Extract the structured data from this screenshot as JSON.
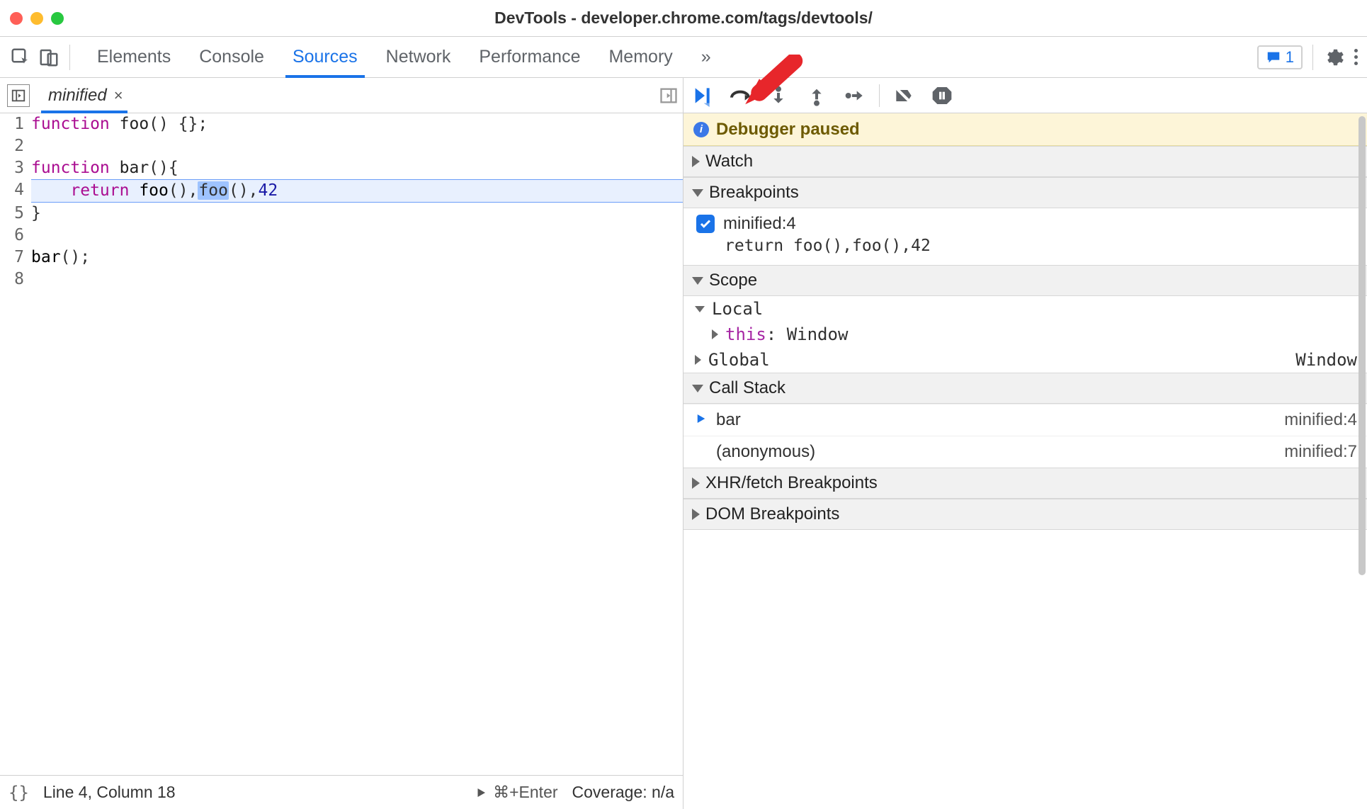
{
  "window": {
    "title": "DevTools - developer.chrome.com/tags/devtools/"
  },
  "topbar": {
    "tabs": [
      "Elements",
      "Console",
      "Sources",
      "Network",
      "Performance",
      "Memory"
    ],
    "active_tab": "Sources",
    "more_glyph": "»",
    "issues_count": "1"
  },
  "source": {
    "file_tab": "minified",
    "lines": [
      {
        "n": "1",
        "seg": [
          [
            "kw",
            "function "
          ],
          [
            "fn",
            "foo"
          ],
          [
            "",
            ""
          ],
          [
            "",
            "() {};"
          ]
        ]
      },
      {
        "n": "2",
        "seg": [
          [
            "",
            ""
          ]
        ]
      },
      {
        "n": "3",
        "seg": [
          [
            "kw",
            "function "
          ],
          [
            "fn",
            "bar"
          ],
          [
            "",
            "(){"
          ]
        ]
      },
      {
        "n": "4",
        "hl": true,
        "seg": [
          [
            "",
            "    "
          ],
          [
            "kw",
            "return "
          ],
          [
            "call",
            "foo"
          ],
          [
            "",
            "(),"
          ],
          [
            "hl",
            "foo"
          ],
          [
            "",
            "(),"
          ],
          [
            "num",
            "42"
          ]
        ]
      },
      {
        "n": "5",
        "seg": [
          [
            "",
            "}"
          ]
        ]
      },
      {
        "n": "6",
        "seg": [
          [
            "",
            ""
          ]
        ]
      },
      {
        "n": "7",
        "seg": [
          [
            "call",
            "bar"
          ],
          [
            "",
            "();"
          ]
        ]
      },
      {
        "n": "8",
        "seg": [
          [
            "",
            ""
          ]
        ]
      }
    ],
    "status": {
      "braces": "{}",
      "pos": "Line 4, Column 18",
      "run_hint": "⌘+Enter",
      "coverage": "Coverage: n/a"
    }
  },
  "debugger": {
    "banner": "Debugger paused",
    "panes": {
      "watch": {
        "title": "Watch"
      },
      "breakpoints": {
        "title": "Breakpoints",
        "items": [
          {
            "label": "minified:4",
            "code": "return foo(),foo(),42",
            "checked": true
          }
        ]
      },
      "scope": {
        "title": "Scope",
        "local_label": "Local",
        "this_label": "this",
        "this_value": "Window",
        "global_label": "Global",
        "global_value": "Window"
      },
      "callstack": {
        "title": "Call Stack",
        "frames": [
          {
            "name": "bar",
            "loc": "minified:4",
            "current": true
          },
          {
            "name": "(anonymous)",
            "loc": "minified:7",
            "current": false
          }
        ]
      },
      "xhr": {
        "title": "XHR/fetch Breakpoints"
      },
      "dom": {
        "title": "DOM Breakpoints"
      }
    }
  }
}
